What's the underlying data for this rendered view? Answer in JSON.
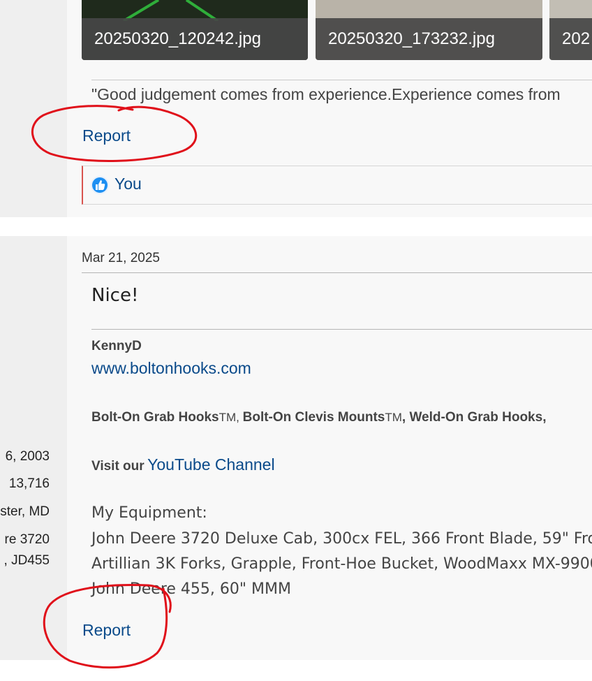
{
  "post1": {
    "attachments": [
      {
        "filename": "20250320_120242.jpg"
      },
      {
        "filename": "20250320_173232.jpg"
      },
      {
        "filename": "202"
      }
    ],
    "signature_quote": "\"Good judgement comes from experience.Experience comes from",
    "report_label": "Report",
    "reaction": {
      "icon": "thumbs-up-icon",
      "label": "You"
    }
  },
  "post2": {
    "user_stats": [
      "6, 2003",
      "13,716",
      "ster, MD",
      "re 3720",
      ", JD455"
    ],
    "date": "Mar 21, 2025",
    "message": "Nice!",
    "signature": {
      "name": "KennyD",
      "website": "www.boltonhooks.com",
      "products": [
        {
          "name": "Bolt-On Grab Hooks",
          "tm": "TM",
          "sep": ", "
        },
        {
          "name": "Bolt-On Clevis Mounts",
          "tm": "TM",
          "sep": ""
        },
        {
          "name": ", Weld-On Grab Hooks,",
          "tm": "",
          "sep": ""
        }
      ],
      "visit_prefix": "Visit our",
      "youtube_label": "YouTube Channel",
      "equipment_title": "My Equipment:",
      "equipment_lines": [
        "John Deere 3720 Deluxe Cab, 300cx FEL, 366 Front Blade, 59\" Fro",
        "Artillian 3K Forks, Grapple, Front-Hoe Bucket, WoodMaxx MX-9900",
        "John Deere 455, 60\" MMM"
      ]
    },
    "report_label": "Report"
  },
  "colors": {
    "link": "#0a4a8a",
    "annotation": "#e0101a",
    "userbar": "#efefef",
    "post_bg": "#f8f8f8"
  }
}
